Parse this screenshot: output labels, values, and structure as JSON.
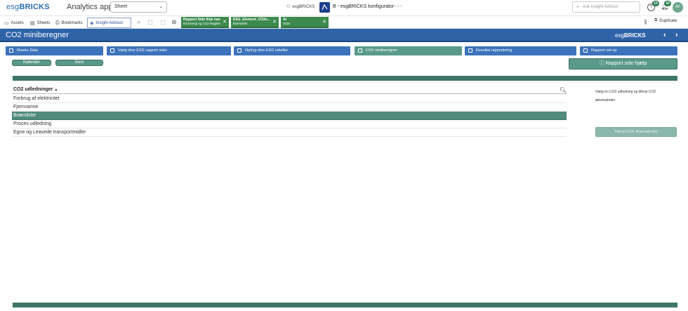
{
  "topbar": {
    "logo_light": "esg",
    "logo_bold": "BRICKS",
    "app_title": "Analytics app",
    "sheet_dropdown": "Sheet",
    "space_name": "esgBRICKS",
    "app_name": "B - esgBRICKS konfigurator",
    "more": "···",
    "ask_placeholder": "Ask Insight Advisor",
    "help_count": "13",
    "notif_count": "10",
    "avatar_initials": "AP"
  },
  "toolbar": {
    "assets": "Assets",
    "sheets": "Sheets",
    "bookmarks": "Bookmarks",
    "insight": "Insight Advisor",
    "duplicate": "Duplicate",
    "selections": [
      {
        "title": "Rapport Side linje navn",
        "value": "B3-Energi og CO2 Nøgletal"
      },
      {
        "title": "ESG_Element_CO2e....",
        "value": "Brændsler"
      },
      {
        "title": "År",
        "value": "2025"
      }
    ]
  },
  "banner": {
    "title": "CO2 miniberegner",
    "logo_light": "esg",
    "logo_bold": "BRICKS",
    "prev": "‹",
    "next": "›"
  },
  "nav": {
    "tabs": [
      {
        "label": "Master Data"
      },
      {
        "label": "Vælg dine ESG rapport sider"
      },
      {
        "label": "Optryg dine ESG tabeller"
      },
      {
        "label": "CO2 miniberegner"
      },
      {
        "label": "Resultat rapportering"
      },
      {
        "label": "Rapport set-up"
      }
    ],
    "active_index": 3
  },
  "buttons": {
    "kalender": "Kalender",
    "gem": "Gem",
    "help": "ⓘ Rapport side hjælp",
    "tilknyt": "Tilknyt CO2 Ækvivalenter"
  },
  "listbox": {
    "header": "CO2 udledninger",
    "sort_glyph": "▲",
    "items": [
      {
        "label": "Forbrug af elektricitet",
        "selected": false
      },
      {
        "label": "Fjernvarme",
        "selected": false
      },
      {
        "label": "Brændsler",
        "selected": true
      },
      {
        "label": "Proces udledning",
        "selected": false
      },
      {
        "label": "Egne og Leasede transportmidler",
        "selected": false
      }
    ]
  },
  "side_note": "Vælg én CO2 udledning og tilknyt CO2 ækvivalenter",
  "colors": {
    "brand_blue": "#2f63a8",
    "teal": "#5a9a8a",
    "selection_green": "#3c8a4e"
  }
}
